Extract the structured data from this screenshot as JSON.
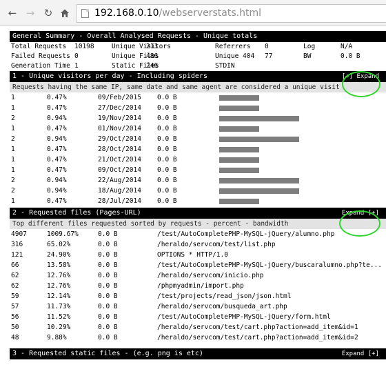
{
  "browser": {
    "url_host": "192.168.0.10",
    "url_path": "/webserverstats.html"
  },
  "summary": {
    "title": "General Summary - Overall Analysed Requests - Unique totals",
    "rows": [
      [
        {
          "label": "Total Requests",
          "value": "10198"
        },
        {
          "label": "Unique Visitors",
          "value": "213"
        },
        {
          "label": "Referrers",
          "value": "0"
        },
        {
          "label": "Log",
          "value": "N/A"
        }
      ],
      [
        {
          "label": "Failed Requests",
          "value": "0"
        },
        {
          "label": "Unique Files",
          "value": "486"
        },
        {
          "label": "Unique 404",
          "value": "77"
        },
        {
          "label": "BW",
          "value": "0.0 B"
        }
      ],
      [
        {
          "label": "Generation Time",
          "value": "1"
        },
        {
          "label": "Static Files",
          "value": "246"
        },
        {
          "label": "STDIN",
          "value": ""
        },
        {
          "label": "",
          "value": ""
        }
      ]
    ]
  },
  "section1": {
    "title": "1 - Unique visitors per day - Including spiders",
    "expand_label": "[+] Expand",
    "description": "Requests having the same IP, same date and same agent are considered a unique visit",
    "rows": [
      {
        "hits": "1",
        "percent": "0.47%",
        "date": "09/Feb/2015",
        "bw": "0.0 B",
        "bar": 0.5
      },
      {
        "hits": "1",
        "percent": "0.47%",
        "date": "27/Dec/2014",
        "bw": "0.0 B",
        "bar": 0.5
      },
      {
        "hits": "2",
        "percent": "0.94%",
        "date": "19/Nov/2014",
        "bw": "0.0 B",
        "bar": 1.0
      },
      {
        "hits": "1",
        "percent": "0.47%",
        "date": "01/Nov/2014",
        "bw": "0.0 B",
        "bar": 0.5
      },
      {
        "hits": "2",
        "percent": "0.94%",
        "date": "29/Oct/2014",
        "bw": "0.0 B",
        "bar": 1.0
      },
      {
        "hits": "1",
        "percent": "0.47%",
        "date": "28/Oct/2014",
        "bw": "0.0 B",
        "bar": 0.5
      },
      {
        "hits": "1",
        "percent": "0.47%",
        "date": "21/Oct/2014",
        "bw": "0.0 B",
        "bar": 0.5
      },
      {
        "hits": "1",
        "percent": "0.47%",
        "date": "09/Oct/2014",
        "bw": "0.0 B",
        "bar": 0.5
      },
      {
        "hits": "2",
        "percent": "0.94%",
        "date": "22/Aug/2014",
        "bw": "0.0 B",
        "bar": 1.0
      },
      {
        "hits": "2",
        "percent": "0.94%",
        "date": "18/Aug/2014",
        "bw": "0.0 B",
        "bar": 1.0
      },
      {
        "hits": "1",
        "percent": "0.47%",
        "date": "28/Jul/2014",
        "bw": "0.0 B",
        "bar": 0.5
      }
    ]
  },
  "section2": {
    "title": "2 - Requested files (Pages-URL)",
    "expand_label": "Expand [+]",
    "description": "Top different files requested sorted by requests - percent - bandwidth",
    "rows": [
      {
        "hits": "4907",
        "percent": "1009.67%",
        "bw": "0.0 B",
        "path": "/test/AutoCompletePHP-MySQL-jQuery/alumno.php"
      },
      {
        "hits": "316",
        "percent": "65.02%",
        "bw": "0.0 B",
        "path": "/heraldo/servcom/test/list.php"
      },
      {
        "hits": "121",
        "percent": "24.90%",
        "bw": "0.0 B",
        "path": "OPTIONS * HTTP/1.0"
      },
      {
        "hits": "66",
        "percent": "13.58%",
        "bw": "0.0 B",
        "path": "/test/AutoCompletePHP-MySQL-jQuery/buscaralumno.php?te..."
      },
      {
        "hits": "62",
        "percent": "12.76%",
        "bw": "0.0 B",
        "path": "/heraldo/servcom/inicio.php"
      },
      {
        "hits": "62",
        "percent": "12.76%",
        "bw": "0.0 B",
        "path": "/phpmyadmin/import.php"
      },
      {
        "hits": "59",
        "percent": "12.14%",
        "bw": "0.0 B",
        "path": "/test/projects/read_json/json.html"
      },
      {
        "hits": "57",
        "percent": "11.73%",
        "bw": "0.0 B",
        "path": "/heraldo/servcom/busqueda_art.php"
      },
      {
        "hits": "56",
        "percent": "11.52%",
        "bw": "0.0 B",
        "path": "/test/AutoCompletePHP-MySQL-jQuery/form.html"
      },
      {
        "hits": "50",
        "percent": "10.29%",
        "bw": "0.0 B",
        "path": "/heraldo/servcom/test/cart.php?action=add_item&id=1"
      },
      {
        "hits": "48",
        "percent": "9.88%",
        "bw": "0.0 B",
        "path": "/heraldo/servcom/test/cart.php?action=add_item&id=2"
      }
    ]
  },
  "section3": {
    "title": "3 - Requested static files - (e.g. png is etc)",
    "expand_label": "Expand [+]"
  },
  "colors": {
    "highlight": "#2fd62f",
    "header_bg": "#000000",
    "bar": "#7e7e7e"
  }
}
